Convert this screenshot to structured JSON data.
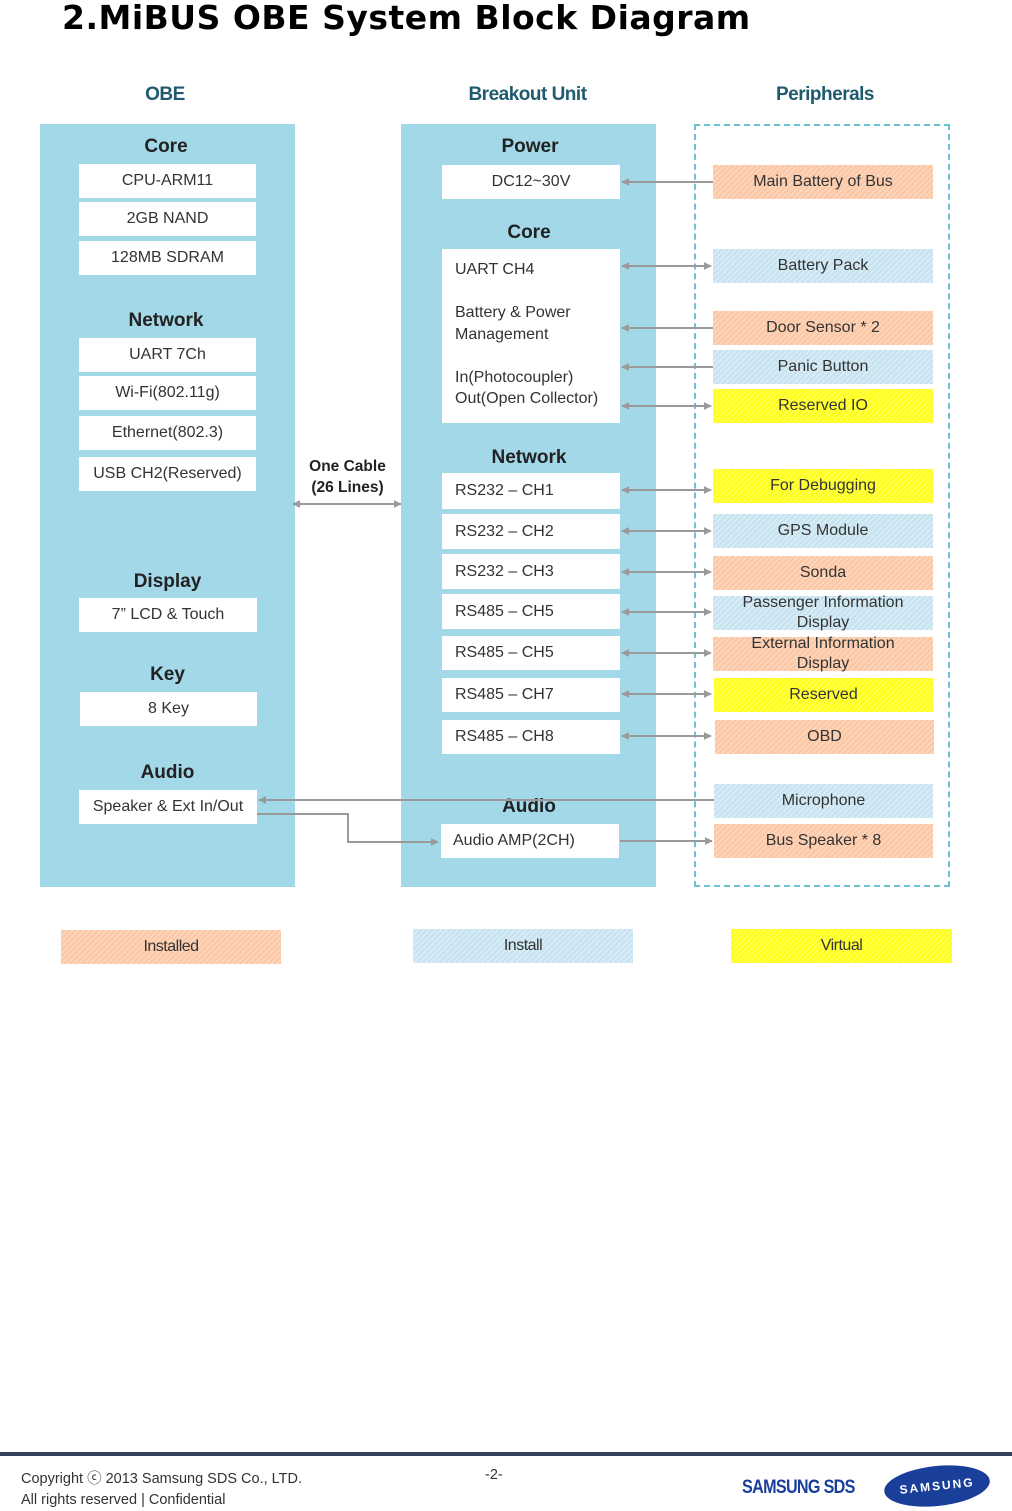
{
  "page_title": "2.MiBUS OBE  System  Block  Diagram",
  "columns": {
    "obe": "OBE",
    "breakout": "Breakout Unit",
    "peripherals": "Peripherals"
  },
  "obe": {
    "sections": [
      {
        "title": "Core",
        "items": [
          "CPU-ARM11",
          "2GB NAND",
          "128MB  SDRAM"
        ]
      },
      {
        "title": "Network",
        "items": [
          "UART  7Ch",
          "Wi-Fi(802.11g)",
          "Ethernet(802.3)",
          "USB CH2(Reserved)"
        ]
      },
      {
        "title": "Display",
        "items": [
          "7” LCD & Touch"
        ]
      },
      {
        "title": "Key",
        "items": [
          "8 Key"
        ]
      },
      {
        "title": "Audio",
        "items": [
          "Speaker  &  Ext  In/Out"
        ]
      }
    ]
  },
  "cable": {
    "line1": "One Cable",
    "line2": "(26 Lines)"
  },
  "breakout": {
    "power": {
      "title": "Power",
      "items": [
        "DC12~30V"
      ]
    },
    "core": {
      "title": "Core",
      "lines": [
        "UART  CH4",
        "Battery & Power",
        "Management",
        "In(Photocoupler)",
        "Out(Open  Collector)"
      ]
    },
    "network": {
      "title": "Network",
      "items": [
        "RS232  – CH1",
        "RS232  – CH2",
        "RS232  – CH3",
        "RS485  – CH5",
        "RS485  – CH5",
        "RS485  – CH7",
        "RS485  – CH8"
      ]
    },
    "audio": {
      "title": "Audio",
      "items": [
        "Audio AMP(2CH)"
      ]
    }
  },
  "peripherals": [
    {
      "label": "Main Battery of Bus",
      "category": "installed",
      "link": "to-breakout"
    },
    {
      "label": "Battery Pack",
      "category": "install",
      "link": "bidirectional"
    },
    {
      "label": "Door Sensor * 2",
      "category": "installed",
      "link": "to-breakout"
    },
    {
      "label": "Panic Button",
      "category": "install",
      "link": "to-breakout"
    },
    {
      "label": "Reserved  IO",
      "category": "virtual",
      "link": "bidirectional"
    },
    {
      "label": "For Debugging",
      "category": "virtual",
      "link": "bidirectional"
    },
    {
      "label": "GPS Module",
      "category": "install",
      "link": "bidirectional"
    },
    {
      "label": "Sonda",
      "category": "installed",
      "link": "bidirectional"
    },
    {
      "label": "Passenger  Information Display",
      "category": "install",
      "link": "bidirectional"
    },
    {
      "label": "External  Information Display",
      "category": "installed",
      "link": "bidirectional"
    },
    {
      "label": "Reserved",
      "category": "virtual",
      "link": "bidirectional"
    },
    {
      "label": "OBD",
      "category": "installed",
      "link": "bidirectional"
    },
    {
      "label": "Microphone",
      "category": "install",
      "link": "to-obe-audio"
    },
    {
      "label": "Bus Speaker * 8",
      "category": "installed",
      "link": "from-breakout"
    }
  ],
  "legend": [
    {
      "label": "Installed",
      "category": "installed"
    },
    {
      "label": "Install",
      "category": "install"
    },
    {
      "label": "Virtual",
      "category": "virtual"
    }
  ],
  "colors": {
    "panel": "#a2d8e7",
    "installed": "#fcc9a8",
    "install": "#c9e4f1",
    "virtual": "#ffff1e",
    "arrow": "#9a9a9a",
    "column_title": "#1f5a6e"
  },
  "footer": {
    "copyright": "Copyright  ⓒ  2013 Samsung SDS Co., LTD.",
    "rights": "All rights reserved    |    Confidential",
    "page_number": "-2-",
    "logo_sds": "SAMSUNG SDS",
    "logo_samsung": "SAMSUNG"
  }
}
